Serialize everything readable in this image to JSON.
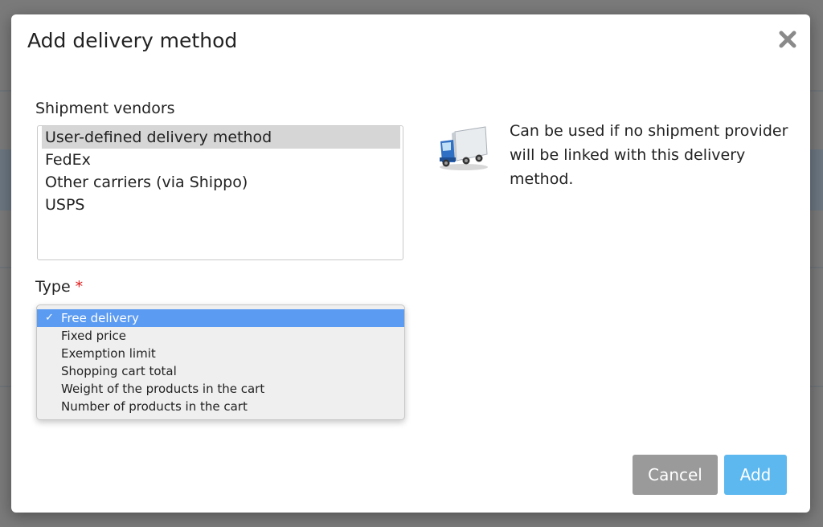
{
  "dialog": {
    "title": "Add delivery method",
    "close_icon": "close-x-icon"
  },
  "vendors": {
    "label": "Shipment vendors",
    "items": [
      {
        "label": "User-defined delivery method",
        "selected": true
      },
      {
        "label": "FedEx",
        "selected": false
      },
      {
        "label": "Other carriers (via Shippo)",
        "selected": false
      },
      {
        "label": "USPS",
        "selected": false
      }
    ]
  },
  "info": {
    "icon": "delivery-truck-icon",
    "text": "Can be used if no shipment provider will be linked with this delivery method."
  },
  "type": {
    "label": "Type",
    "required_mark": "*",
    "check_mark": "✓",
    "options": [
      {
        "label": "Free delivery",
        "selected": true
      },
      {
        "label": "Fixed price",
        "selected": false
      },
      {
        "label": "Exemption limit",
        "selected": false
      },
      {
        "label": "Shopping cart total",
        "selected": false
      },
      {
        "label": "Weight of the products in the cart",
        "selected": false
      },
      {
        "label": "Number of products in the cart",
        "selected": false
      }
    ]
  },
  "buttons": {
    "cancel": "Cancel",
    "add": "Add"
  },
  "colors": {
    "accent": "#5b9bf2",
    "add_button": "#5cb8ef",
    "cancel_button": "#9a9a9a",
    "required": "#e01818"
  }
}
